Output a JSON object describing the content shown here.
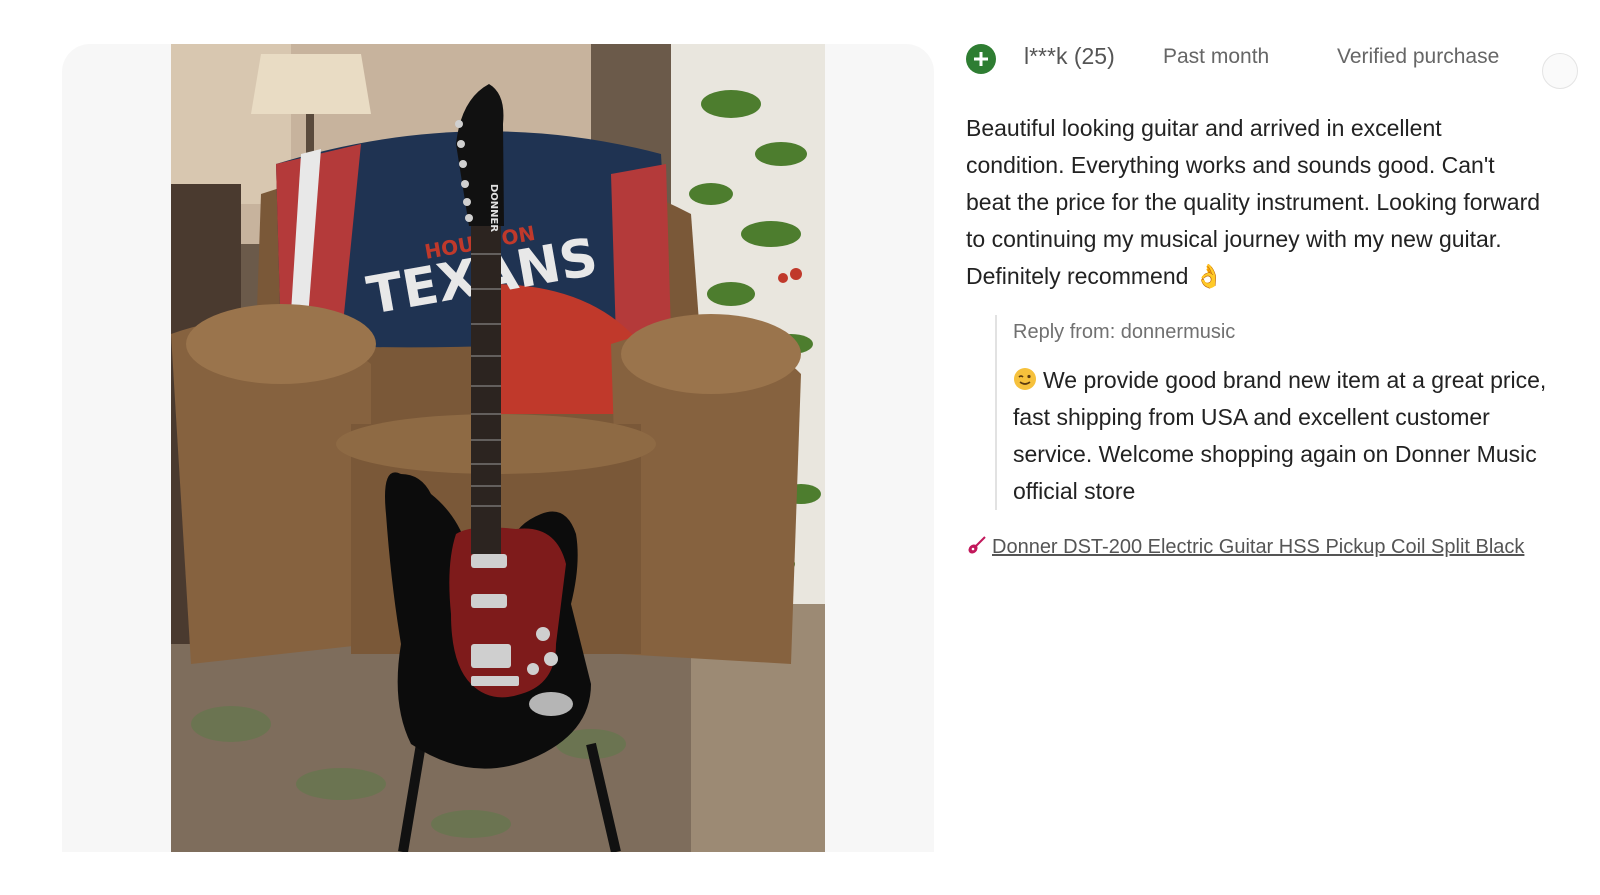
{
  "review": {
    "username": "l***k (25)",
    "date": "Past month",
    "verified": "Verified purchase",
    "text": "Beautiful looking guitar and arrived in excellent condition. Everything works and sounds good. Can't beat the price for the quality instrument. Looking forward to continuing my musical journey with my new guitar. Definitely recommend 👌",
    "reply_label": "Reply from: donnermusic",
    "reply_text": "We provide good brand new item at a great price, fast shipping from USA and excellent customer service. Welcome shopping again on Donner Music official store",
    "product_link": "Donner DST-200 Electric Guitar HSS Pickup Coil Split Black"
  },
  "photo": {
    "blanket_text_top": "HOUSTON",
    "blanket_text": "TEXANS",
    "headstock_text": "DONNER"
  },
  "icons": {
    "follow": "plus-circle-icon",
    "reply_emoji": "wink-face-icon",
    "link": "guitar-icon"
  },
  "colors": {
    "follow_green": "#2e7d32",
    "link_text": "#555555",
    "pickguard_red": "#8b1a1a"
  }
}
